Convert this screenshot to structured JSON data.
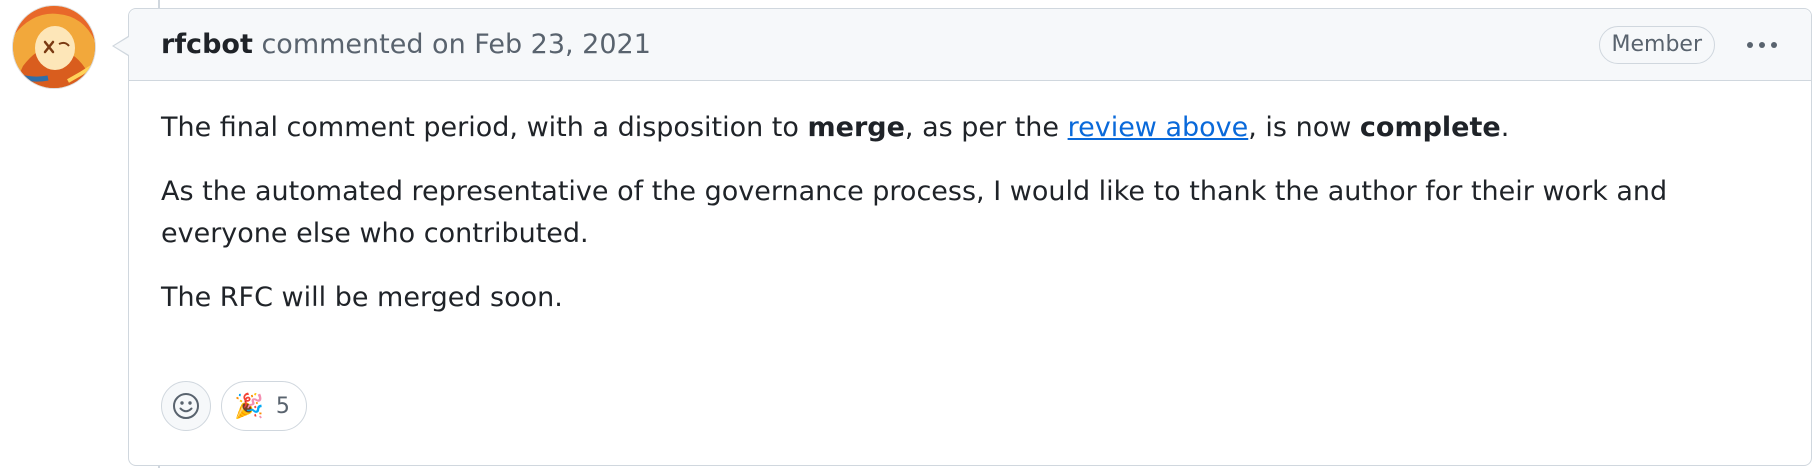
{
  "comment": {
    "author": "rfcbot",
    "action_text": "commented on Feb 23, 2021",
    "role_badge": "Member",
    "body": {
      "p1_part1": "The final comment period, with a disposition to ",
      "p1_bold1": "merge",
      "p1_part2": ", as per the ",
      "p1_link": "review above",
      "p1_part3": ", is now ",
      "p1_bold2": "complete",
      "p1_part4": ".",
      "p2": "As the automated representative of the governance process, I would like to thank the author for their work and everyone else who contributed.",
      "p3": "The RFC will be merged soon."
    },
    "reactions": [
      {
        "emoji": "🎉",
        "count": "5"
      }
    ]
  },
  "colors": {
    "border": "#d0d7de",
    "header_bg": "#f6f8fa",
    "link": "#0969da",
    "muted": "#59636e",
    "text": "#1f2328"
  },
  "icons": {
    "avatar": "rfcbot-avatar",
    "more": "kebab-horizontal-icon",
    "add_reaction": "smiley-icon"
  }
}
